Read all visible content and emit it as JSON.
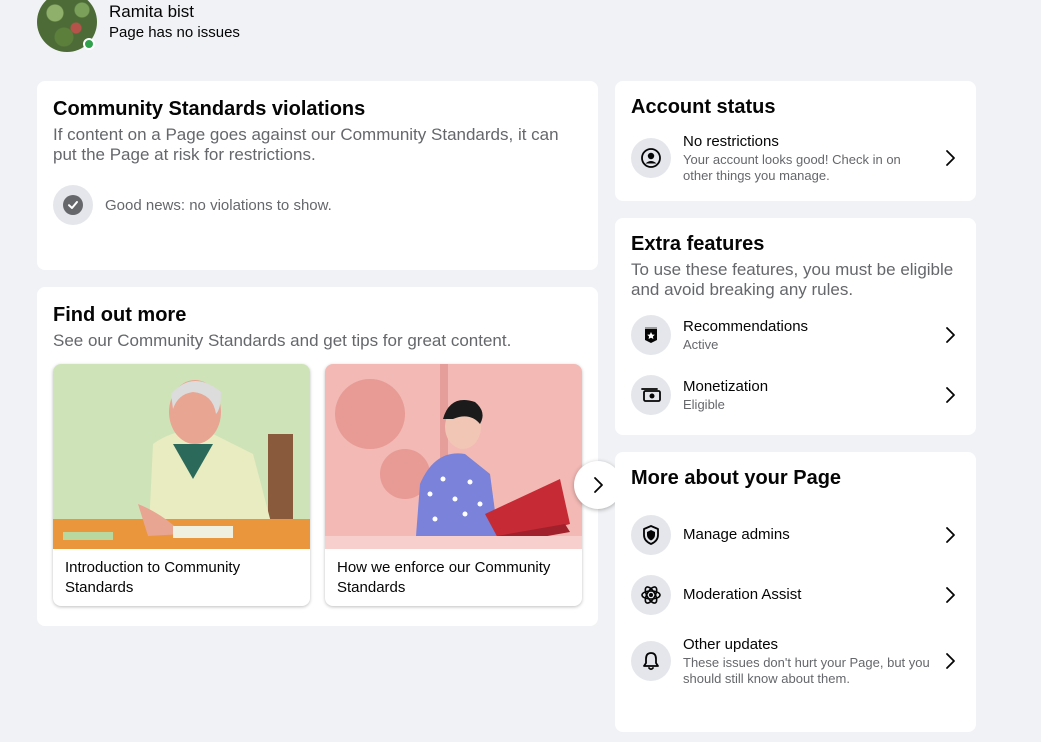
{
  "profile": {
    "name": "Ramita bist",
    "status": "Page has no issues",
    "avatar_icon": "profile-photo"
  },
  "violations": {
    "title": "Community Standards violations",
    "description": "If content on a Page goes against our Community Standards, it can put the Page at risk for restrictions.",
    "good_news": "Good news: no violations to show.",
    "icon": "check-circle-icon"
  },
  "find_more": {
    "title": "Find out more",
    "description": "See our Community Standards and get tips for great content.",
    "tiles": [
      {
        "label": "Introduction to Community Standards",
        "image": "man-at-desk-illustration"
      },
      {
        "label": "How we enforce our Community Standards",
        "image": "woman-at-laptop-illustration"
      }
    ],
    "next_icon": "chevron-right-icon"
  },
  "account_status": {
    "title": "Account status",
    "item": {
      "title": "No restrictions",
      "subtitle": "Your account looks good! Check in on other things you manage.",
      "icon": "user-circle-icon"
    }
  },
  "extra_features": {
    "title": "Extra features",
    "description": "To use these features, you must be eligible and avoid breaking any rules.",
    "items": [
      {
        "title": "Recommendations",
        "subtitle": "Active",
        "icon": "recommendation-badge-icon"
      },
      {
        "title": "Monetization",
        "subtitle": "Eligible",
        "icon": "money-icon"
      }
    ]
  },
  "more_about": {
    "title": "More about your Page",
    "items": [
      {
        "title": "Manage admins",
        "icon": "shield-icon"
      },
      {
        "title": "Moderation Assist",
        "icon": "gear-icon"
      },
      {
        "title": "Other updates",
        "subtitle": "These issues don't hurt your Page, but you should still know about them.",
        "icon": "bell-icon"
      }
    ]
  },
  "colors": {
    "background": "#f0f2f5",
    "card": "#ffffff",
    "secondary_text": "#65676b",
    "icon_bg": "#e4e6eb",
    "online": "#31a24c"
  }
}
